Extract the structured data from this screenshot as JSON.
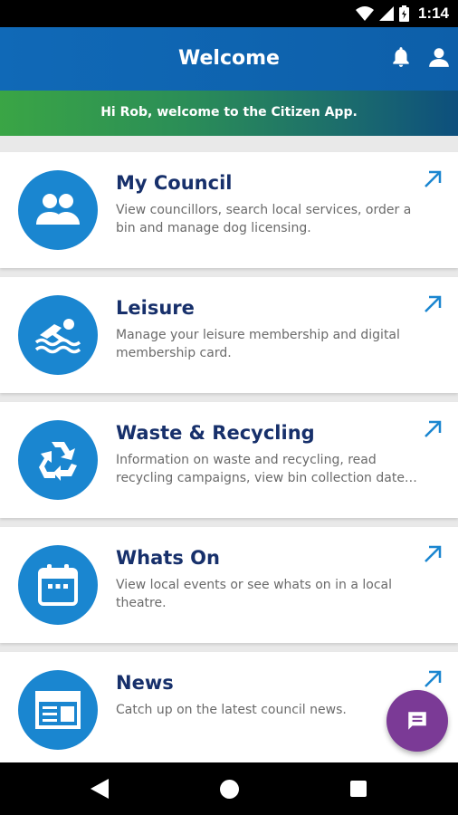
{
  "status_bar": {
    "time": "1:14"
  },
  "app_bar": {
    "title": "Welcome"
  },
  "banner": {
    "text": "Hi Rob, welcome to the Citizen App."
  },
  "cards": [
    {
      "title": "My Council",
      "description": "View councillors, search local services, order a bin and manage dog licensing.",
      "icon": "people-icon"
    },
    {
      "title": "Leisure",
      "description": "Manage your leisure membership and digital membership card.",
      "icon": "swimmer-icon"
    },
    {
      "title": "Waste & Recycling",
      "description": "Information on waste and recycling, read recycling campaigns, view bin collection date…",
      "icon": "recycle-icon"
    },
    {
      "title": "Whats On",
      "description": "View local events or see whats on in a local theatre.",
      "icon": "calendar-icon"
    },
    {
      "title": "News",
      "description": "Catch up on the latest council news.",
      "icon": "newspaper-icon"
    }
  ],
  "colors": {
    "app_bar": "#1069b7",
    "card_title": "#17306b",
    "icon_circle": "#1a86d0",
    "fab": "#7b3a96"
  }
}
